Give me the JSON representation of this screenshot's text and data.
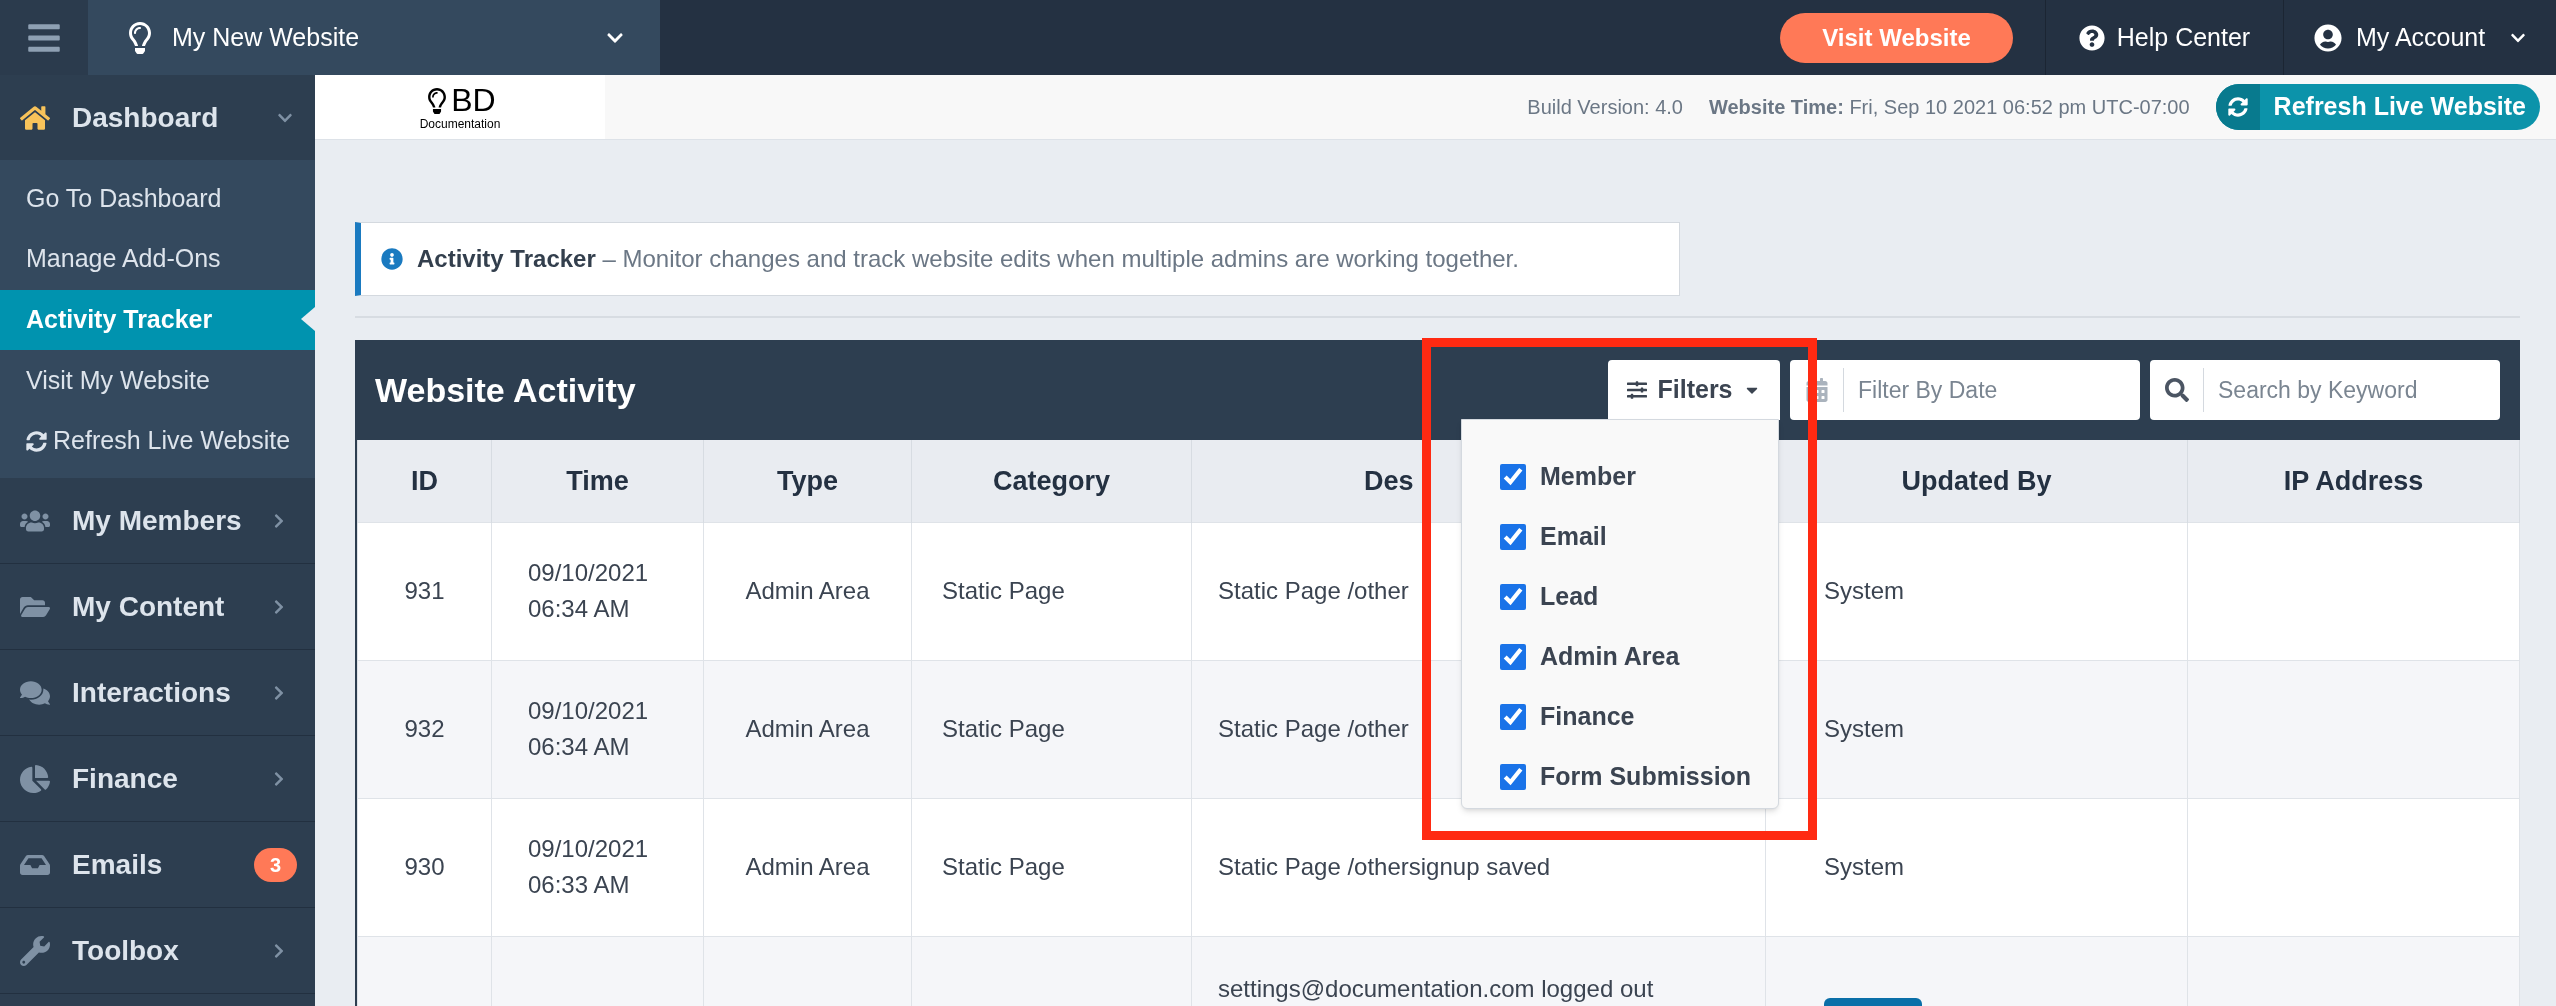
{
  "top_bar": {
    "site_name": "My New Website",
    "visit_button": "Visit Website",
    "help": "Help Center",
    "account": "My Account"
  },
  "header_strip": {
    "logo": {
      "letters": "BD",
      "caption": "Documentation"
    },
    "build_version": "Build Version: 4.0",
    "website_time_label": "Website Time:",
    "website_time": "Fri, Sep 10 2021 06:52 pm UTC-07:00",
    "refresh_button": "Refresh Live Website"
  },
  "sidebar": {
    "sections": [
      {
        "label": "Dashboard",
        "expanded": true,
        "children": [
          {
            "label": "Go To Dashboard",
            "selected": false,
            "kind": "link"
          },
          {
            "label": "Manage Add-Ons",
            "selected": false,
            "kind": "link"
          },
          {
            "label": "Activity Tracker",
            "selected": true,
            "kind": "link"
          },
          {
            "label": "Visit My Website",
            "selected": false,
            "kind": "link"
          },
          {
            "label": "Refresh Live Website",
            "selected": false,
            "kind": "action"
          }
        ]
      },
      {
        "label": "My Members",
        "expanded": false
      },
      {
        "label": "My Content",
        "expanded": false
      },
      {
        "label": "Interactions",
        "expanded": false
      },
      {
        "label": "Finance",
        "expanded": false
      },
      {
        "label": "Emails",
        "badge": "3"
      },
      {
        "label": "Toolbox",
        "expanded": false
      }
    ]
  },
  "info": {
    "text": "**Activity Tracker** – Monitor changes and track website edits when multiple admins are working together."
  },
  "panel": {
    "title": "Website Activity",
    "filters_button": "Filters",
    "filters_open": true,
    "filter_options": [
      {
        "label": "Member",
        "checked": true
      },
      {
        "label": "Email",
        "checked": true
      },
      {
        "label": "Lead",
        "checked": true
      },
      {
        "label": "Admin Area",
        "checked": true
      },
      {
        "label": "Finance",
        "checked": true
      },
      {
        "label": "Form Submission",
        "checked": true
      }
    ],
    "date_placeholder": "Filter By Date",
    "search_placeholder": "Search by Keyword"
  },
  "table": {
    "columns": [
      {
        "label": "ID"
      },
      {
        "label": "Time"
      },
      {
        "label": "Type"
      },
      {
        "label": "Category"
      },
      {
        "label": "Des",
        "cut": true
      },
      {
        "label": "Updated By"
      },
      {
        "label": "IP Address"
      }
    ],
    "rows": [
      {
        "id": "931",
        "time": "09/10/2021 06:34 AM",
        "type": "Admin Area",
        "category": "Static Page",
        "description": "Static Page /other",
        "updated_by": {
          "kind": "text",
          "text": "System"
        }
      },
      {
        "id": "932",
        "time": "09/10/2021 06:34 AM",
        "type": "Admin Area",
        "category": "Static Page",
        "description": "Static Page /other",
        "updated_by": {
          "kind": "text",
          "text": "System"
        }
      },
      {
        "id": "930",
        "time": "09/10/2021 06:33 AM",
        "type": "Admin Area",
        "category": "Static Page",
        "description": "Static Page /othersignup saved",
        "updated_by": {
          "kind": "text",
          "text": "System"
        }
      },
      {
        "description": "settings@documentation.com logged out",
        "updated_by": {
          "kind": "button"
        }
      }
    ]
  },
  "annotation": {
    "highlight_frame": true
  }
}
